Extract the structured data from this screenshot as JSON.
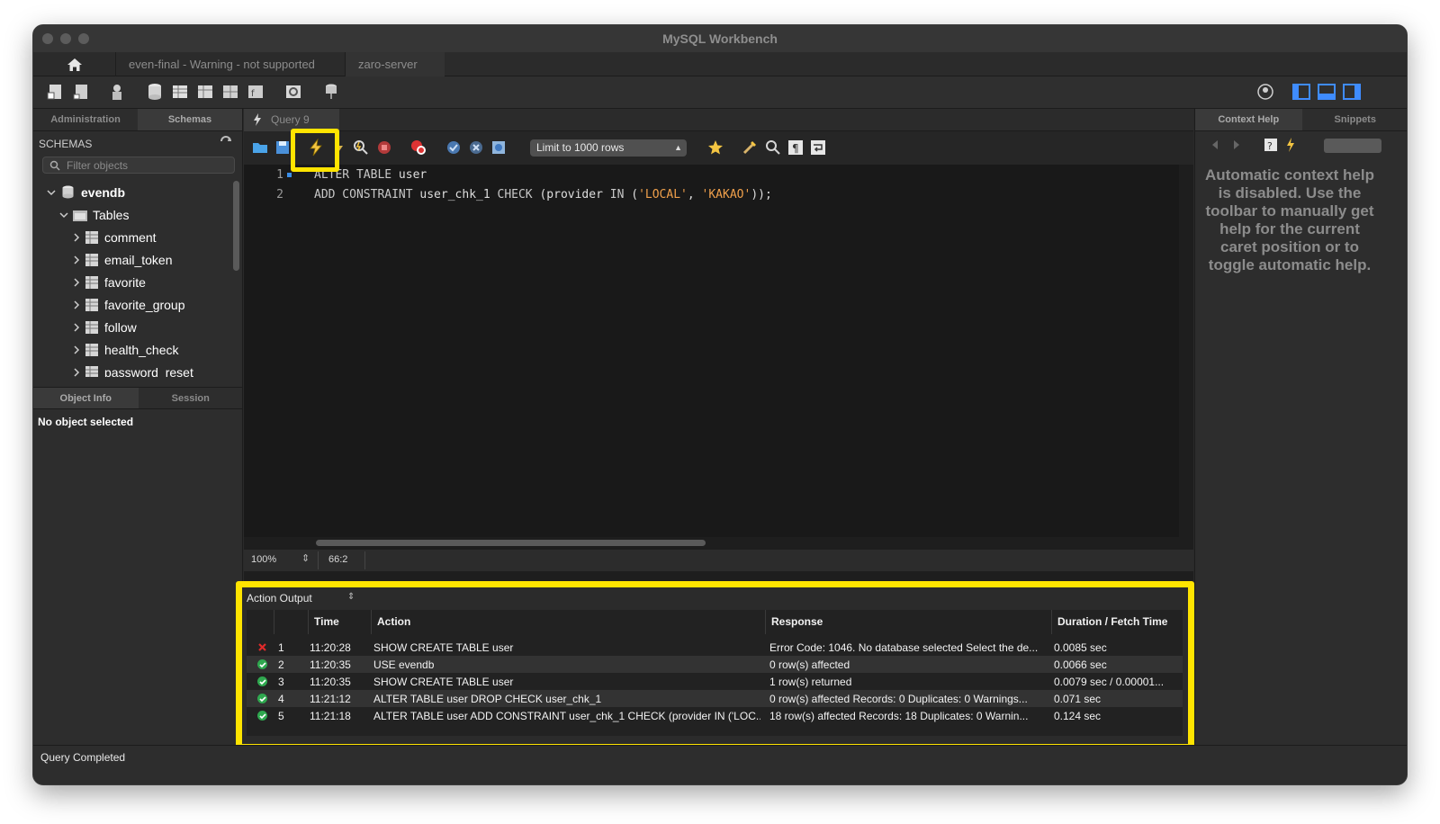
{
  "window": {
    "title": "MySQL Workbench"
  },
  "connection_tabs": [
    {
      "label": "even-final - Warning - not supported"
    },
    {
      "label": "zaro-server"
    }
  ],
  "sidebar": {
    "tabs": [
      "Administration",
      "Schemas"
    ],
    "header": "SCHEMAS",
    "filter_placeholder": "Filter objects",
    "tree": {
      "schema": "evendb",
      "tables_label": "Tables",
      "tables": [
        "comment",
        "email_token",
        "favorite",
        "favorite_group",
        "follow",
        "health_check",
        "password_reset"
      ]
    },
    "object_tabs": [
      "Object Info",
      "Session"
    ],
    "object_info": "No object selected"
  },
  "editor": {
    "tab_label": "Query 9",
    "limit_select": "Limit to 1000 rows",
    "lines": [
      {
        "no": "1",
        "parts": [
          {
            "cls": "kw",
            "text": "ALTER TABLE "
          },
          {
            "cls": "ident",
            "text": "user"
          }
        ]
      },
      {
        "no": "2",
        "parts": [
          {
            "cls": "kw",
            "text": "ADD CONSTRAINT "
          },
          {
            "cls": "ident",
            "text": "user_chk_1 "
          },
          {
            "cls": "kw",
            "text": "CHECK "
          },
          {
            "cls": "punc",
            "text": "(provider "
          },
          {
            "cls": "kw",
            "text": "IN "
          },
          {
            "cls": "punc",
            "text": "("
          },
          {
            "cls": "str",
            "text": "'LOCAL'"
          },
          {
            "cls": "punc",
            "text": ", "
          },
          {
            "cls": "str",
            "text": "'KAKAO'"
          },
          {
            "cls": "punc",
            "text": "));"
          }
        ]
      }
    ],
    "zoom": "100%",
    "caret": "66:2"
  },
  "output": {
    "selector": "Action Output",
    "columns": [
      "Time",
      "Action",
      "Response",
      "Duration / Fetch Time"
    ],
    "rows": [
      {
        "status": "error",
        "num": "1",
        "time": "11:20:28",
        "action": "SHOW CREATE TABLE user",
        "response": "Error Code: 1046. No database selected Select the de...",
        "duration": "0.0085 sec"
      },
      {
        "status": "ok",
        "num": "2",
        "time": "11:20:35",
        "action": "USE evendb",
        "response": "0 row(s) affected",
        "duration": "0.0066 sec"
      },
      {
        "status": "ok",
        "num": "3",
        "time": "11:20:35",
        "action": "SHOW CREATE TABLE user",
        "response": "1 row(s) returned",
        "duration": "0.0079 sec / 0.00001..."
      },
      {
        "status": "ok",
        "num": "4",
        "time": "11:21:12",
        "action": "ALTER TABLE user DROP CHECK user_chk_1",
        "response": "0 row(s) affected Records: 0  Duplicates: 0  Warnings...",
        "duration": "0.071 sec"
      },
      {
        "status": "ok",
        "num": "5",
        "time": "11:21:18",
        "action": "ALTER TABLE user ADD CONSTRAINT user_chk_1 CHECK (provider IN ('LOC...",
        "response": "18 row(s) affected Records: 18  Duplicates: 0  Warnin...",
        "duration": "0.124 sec"
      }
    ]
  },
  "status_bar": "Query Completed",
  "right_panel": {
    "tabs": [
      "Context Help",
      "Snippets"
    ],
    "help_text": "Automatic context help is disabled. Use the toolbar to manually get help for the current caret position or to toggle automatic help."
  },
  "colors": {
    "highlight": "#ffe400",
    "ok": "#2fa84f",
    "error": "#e02a2a",
    "string": "#f0a04b"
  }
}
